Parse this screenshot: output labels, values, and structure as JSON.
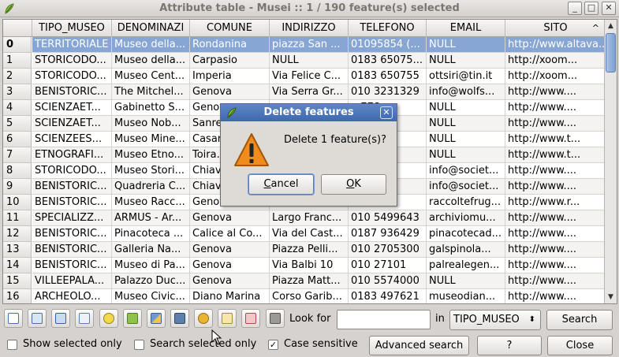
{
  "window": {
    "title": "Attribute table - Musei :: 1 / 190 feature(s) selected",
    "btn_min": "_",
    "btn_max": "□",
    "btn_close": "✕"
  },
  "table": {
    "columns": [
      "TIPO_MUSEO",
      "DENOMINAZI",
      "COMUNE",
      "INDIRIZZO",
      "TELEFONO",
      "EMAIL",
      "SITO"
    ],
    "sort_indicator": "^",
    "rows": [
      {
        "id": "0",
        "cells": [
          "TERRITORIALE",
          "Museo della...",
          "Rondanina",
          "piazza San ...",
          "01095854 (...",
          "NULL",
          "http://www.altava..."
        ]
      },
      {
        "id": "1",
        "cells": [
          "STORICODO...",
          "Museo della...",
          "Carpasio",
          "NULL",
          "0183 65075...",
          "NULL",
          "http://xoom..."
        ]
      },
      {
        "id": "2",
        "cells": [
          "STORICODO...",
          "Museo Cent...",
          "Imperia",
          "Via Felice C...",
          "0183 650755",
          "ottsiri@tin.it",
          "http://xoom..."
        ]
      },
      {
        "id": "3",
        "cells": [
          "BENISTORIC...",
          "The Mitchel...",
          "Genova",
          "Via Serra Gr...",
          "010 3231329",
          "info@wolfs...",
          "http://www...."
        ]
      },
      {
        "id": "4",
        "cells": [
          "SCIENZAET...",
          "Gabinetto S...",
          "Genova",
          "",
          "...778",
          "NULL",
          "http://www...."
        ]
      },
      {
        "id": "5",
        "cells": [
          "SCIENZAET...",
          "Museo Nob...",
          "Sanre...",
          "",
          "...304",
          "NULL",
          "http://www...."
        ]
      },
      {
        "id": "6",
        "cells": [
          "SCIENZEES...",
          "Museo Mine...",
          "Casar...",
          "",
          "...29",
          "NULL",
          "http://www.t..."
        ]
      },
      {
        "id": "7",
        "cells": [
          "ETNOGRAFI...",
          "Museo Etno...",
          "Toira...",
          "",
          "",
          "NULL",
          "http://www.t..."
        ]
      },
      {
        "id": "8",
        "cells": [
          "STORICODO...",
          "Museo Stori...",
          "Chiav...",
          "",
          "...71...",
          "info@societ...",
          "http://www...."
        ]
      },
      {
        "id": "9",
        "cells": [
          "BENISTORIC...",
          "Quadreria C...",
          "Chiav...",
          "",
          "...71...",
          "info@societ...",
          "http://www...."
        ]
      },
      {
        "id": "10",
        "cells": [
          "BENISTORIC...",
          "Museo Racc...",
          "Genov...",
          "",
          "...96",
          "raccoltefrug...",
          "http://www.r..."
        ]
      },
      {
        "id": "11",
        "cells": [
          "SPECIALIZZ...",
          "ARMUS - Ar...",
          "Genova",
          "Largo Franc...",
          "010 5499643",
          "archiviomu...",
          "http://www...."
        ]
      },
      {
        "id": "12",
        "cells": [
          "BENISTORIC...",
          "Pinacoteca ...",
          "Calice al Co...",
          "Via del Cast...",
          "0187 936429",
          "pinacotecad...",
          "http://www...."
        ]
      },
      {
        "id": "13",
        "cells": [
          "BENISTORIC...",
          "Galleria Na...",
          "Genova",
          "Piazza Pelli...",
          "010 2705300",
          "galspinola...",
          "http://www...."
        ]
      },
      {
        "id": "14",
        "cells": [
          "BENISTORIC...",
          "Museo di Pa...",
          "Genova",
          "Via Balbi 10",
          "010 27101",
          "palrealegen...",
          "http://www...."
        ]
      },
      {
        "id": "15",
        "cells": [
          "VILLEEPALA...",
          "Palazzo Duc...",
          "Genova",
          "Piazza Matt...",
          "010 5574000",
          "NULL",
          "http://www...."
        ]
      },
      {
        "id": "16",
        "cells": [
          "ARCHEOLO...",
          "Museo Civic...",
          "Diano Marina",
          "Corso Garib...",
          "0183 497621",
          "museodian...",
          "http://www...."
        ]
      }
    ]
  },
  "scrollbar": {
    "up": "▲",
    "down": "▼"
  },
  "toolbar": {
    "look_for_label": "Look for",
    "in_label": "in",
    "search_value": "",
    "field_combo": "TIPO_MUSEO",
    "search_button": "Search"
  },
  "options": {
    "show_selected_only": "Show selected only",
    "search_selected_only": "Search selected only",
    "case_sensitive": "Case sensitive",
    "advanced_search": "Advanced search",
    "help": "?",
    "close": "Close"
  },
  "dialog": {
    "title": "Delete features",
    "message": "Delete 1 feature(s)?",
    "cancel_u": "C",
    "cancel_rest": "ancel",
    "ok_u": "O",
    "ok_rest": "K",
    "close_glyph": "✕"
  },
  "colors": {
    "selection": "#87a6d3",
    "dialog_title": "#4a75b8",
    "warning": "#f08c1e"
  }
}
